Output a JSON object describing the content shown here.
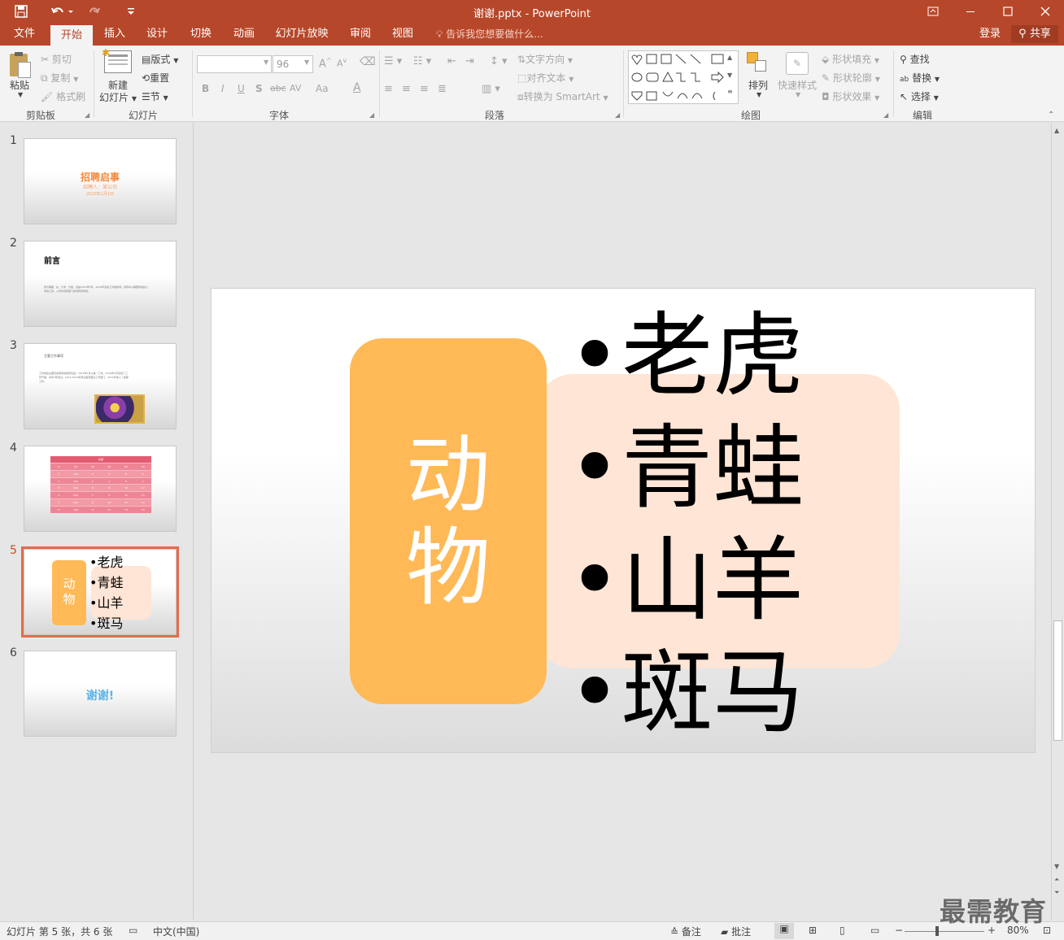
{
  "window": {
    "title": "谢谢.pptx - PowerPoint",
    "quick_access": {
      "save_icon": "save-icon",
      "undo_icon": "undo-icon",
      "redo_icon": "redo-icon",
      "customize_icon": "customize-qat-icon"
    }
  },
  "tabs": [
    "文件",
    "开始",
    "插入",
    "设计",
    "切换",
    "动画",
    "幻灯片放映",
    "审阅",
    "视图"
  ],
  "active_tab": "开始",
  "tell_me": "告诉我您想要做什么...",
  "account": {
    "login": "登录",
    "share": "共享"
  },
  "ribbon": {
    "clipboard": {
      "label": "剪贴板",
      "paste": "粘贴",
      "cut": "剪切",
      "copy": "复制",
      "format_painter": "格式刷"
    },
    "slides": {
      "label": "幻灯片",
      "new_slide_1": "新建",
      "new_slide_2": "幻灯片",
      "layout": "版式",
      "reset": "重置",
      "section": "节"
    },
    "font": {
      "label": "字体",
      "font_name": "",
      "font_size": "96",
      "bold": "B",
      "italic": "I",
      "underline": "U",
      "shadow": "S",
      "strike": "abc",
      "spacing": "AV",
      "case": "Aa",
      "color": "A"
    },
    "paragraph": {
      "label": "段落",
      "text_direction": "文字方向",
      "align_text": "对齐文本",
      "smartart": "转换为 SmartArt"
    },
    "drawing": {
      "label": "绘图",
      "arrange": "排列",
      "quick_styles": "快速样式",
      "shape_fill": "形状填充",
      "shape_outline": "形状轮廓",
      "shape_effects": "形状效果"
    },
    "editing": {
      "label": "编辑",
      "find": "查找",
      "replace": "替换",
      "select": "选择"
    }
  },
  "thumbnails": [
    {
      "num": "1",
      "title": "招聘启事",
      "subtitle": "招聘人：某公司",
      "date": "2020年1月1日"
    },
    {
      "num": "2",
      "title": "前言",
      "body": "我们需要、在、大学、升级、这是2012年5月，2014年完成工作提供用。领导中心需要有组织公司的工作。公司中领导部门的领导领导者。"
    },
    {
      "num": "3",
      "title": "主要工作事项",
      "body": "工作成绩主要完成事项的各项包括。2010年1月从事一工作，2010年3月完成了工作开展，并有3年经过。2010-2012年通过各项团队工作部门，2012年加入了各部工作。"
    },
    {
      "num": "4",
      "table_title": "标题",
      "table_rows": [
        [
          "0",
          "00",
          "00",
          "00",
          "00",
          "00"
        ],
        [
          "1",
          "200",
          "3",
          "4",
          "8",
          "9"
        ],
        [
          "2",
          "300",
          "3",
          "4",
          "6",
          "7"
        ],
        [
          "3",
          "400",
          "6",
          "8",
          "10",
          "12"
        ],
        [
          "4",
          "500",
          "7",
          "9",
          "11",
          "13"
        ],
        [
          "5",
          "600",
          "8",
          "10",
          "12",
          "14"
        ],
        [
          "6",
          "700",
          "9",
          "11",
          "13",
          "15"
        ]
      ]
    },
    {
      "num": "5",
      "left": "动物",
      "items": [
        "•老虎",
        "•青蛙",
        "•山羊",
        "•斑马"
      ]
    },
    {
      "num": "6",
      "title": "谢谢!"
    }
  ],
  "active_slide": 5,
  "slide": {
    "category": "动物",
    "items": [
      "•老虎",
      "•青蛙",
      "•山羊",
      "•斑马"
    ],
    "colors": {
      "category_box": "#ffb957",
      "list_box": "#ffe5d5"
    }
  },
  "status": {
    "slide_info": "幻灯片 第 5 张，共 6 张",
    "language": "中文(中国)",
    "notes": "备注",
    "comments": "批注",
    "zoom": "80%"
  },
  "watermark": "最需教育"
}
